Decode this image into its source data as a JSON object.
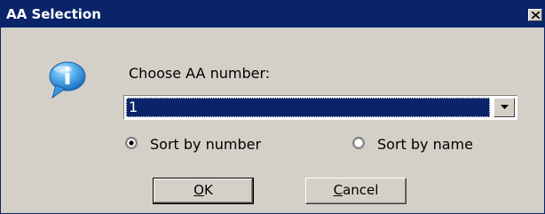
{
  "window": {
    "title": "AA Selection",
    "close_glyph": "×"
  },
  "main": {
    "prompt": "Choose AA number:",
    "select_value": "1",
    "radios": [
      {
        "label": "Sort by number",
        "checked": true
      },
      {
        "label": "Sort by name",
        "checked": false
      }
    ]
  },
  "buttons": {
    "ok": {
      "mnemonic": "O",
      "rest": "K"
    },
    "cancel": {
      "mnemonic": "C",
      "rest": "ancel"
    }
  },
  "icons": {
    "info": "info-icon",
    "close": "close-icon",
    "dropdown": "chevron-down-icon"
  },
  "colors": {
    "titlebar": "#0a246a",
    "dialog_bg": "#d4d0c8",
    "selection": "#0a246a"
  }
}
